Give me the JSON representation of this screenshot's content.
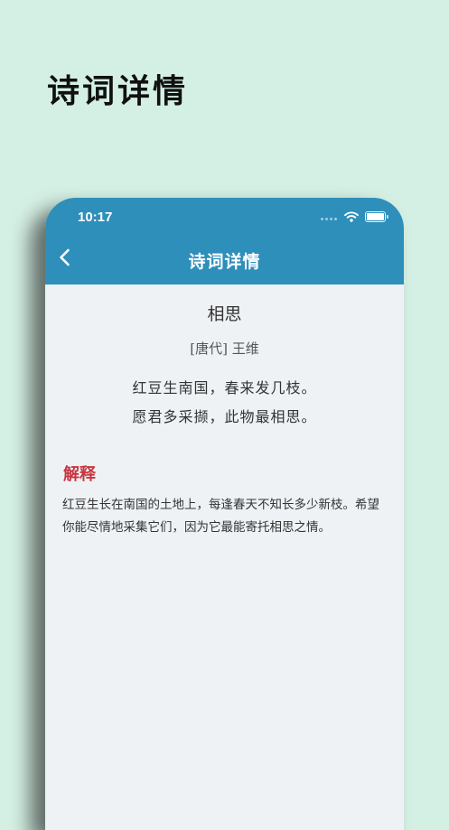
{
  "promo": {
    "title": "诗词详情"
  },
  "status_bar": {
    "time": "10:17"
  },
  "nav": {
    "title": "诗词详情"
  },
  "poem": {
    "title": "相思",
    "author": "[唐代] 王维",
    "lines": [
      "红豆生南国，春来发几枝。",
      "愿君多采撷，此物最相思。"
    ]
  },
  "explanation": {
    "heading": "解释",
    "text": "红豆生长在南国的土地上，每逢春天不知长多少新枝。希望你能尽情地采集它们，因为它最能寄托相思之情。"
  },
  "icons": {
    "back": "chevron-left-icon",
    "wifi": "wifi-icon",
    "battery": "battery-icon",
    "signal": "signal-icon"
  },
  "colors": {
    "background": "#d4efe3",
    "appbar": "#2e8fbb",
    "content_bg": "#eef2f5",
    "accent": "#c9353e"
  }
}
